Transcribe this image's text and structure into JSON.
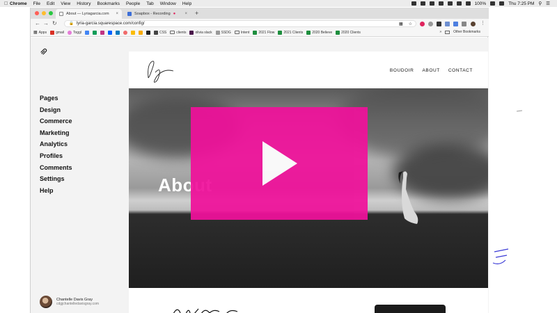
{
  "menubar": {
    "app": "Chrome",
    "menus": [
      "File",
      "Edit",
      "View",
      "History",
      "Bookmarks",
      "People",
      "Tab",
      "Window",
      "Help"
    ],
    "battery": "100%",
    "clock": "Thu 7:25 PM"
  },
  "browser": {
    "tabs": [
      {
        "title": "About — Lyriagarcia.com",
        "active": true
      },
      {
        "title": "Soapbox - Recording",
        "active": false
      }
    ],
    "url": "lyria-garcia.squarespace.com/config/",
    "bookmarks": [
      "Apps",
      "gmail",
      "Toggl",
      "CSS",
      "clients",
      "olivia slack",
      "SSDG",
      "Intent",
      "2021 Flow",
      "2021 Clients",
      "2020 Believe",
      "2020 Clients"
    ],
    "other_bookmarks": "Other Bookmarks",
    "colors": {
      "close": "#ff5f57",
      "minimize": "#febc2e",
      "maximize": "#28c840",
      "sheet": "#1e8e3e"
    }
  },
  "sidebar": {
    "items": [
      {
        "label": "Pages"
      },
      {
        "label": "Design"
      },
      {
        "label": "Commerce"
      },
      {
        "label": "Marketing"
      },
      {
        "label": "Analytics"
      },
      {
        "label": "Profiles"
      },
      {
        "label": "Comments"
      },
      {
        "label": "Settings"
      },
      {
        "label": "Help"
      }
    ],
    "user": {
      "name": "Chantelle Davis Gray",
      "email": "cdgjchantelledavisgray.com"
    }
  },
  "site": {
    "nav": [
      "BOUDOIR",
      "ABOUT",
      "CONTACT"
    ],
    "hero_title": "About",
    "overlay_color": "#f0119b"
  }
}
